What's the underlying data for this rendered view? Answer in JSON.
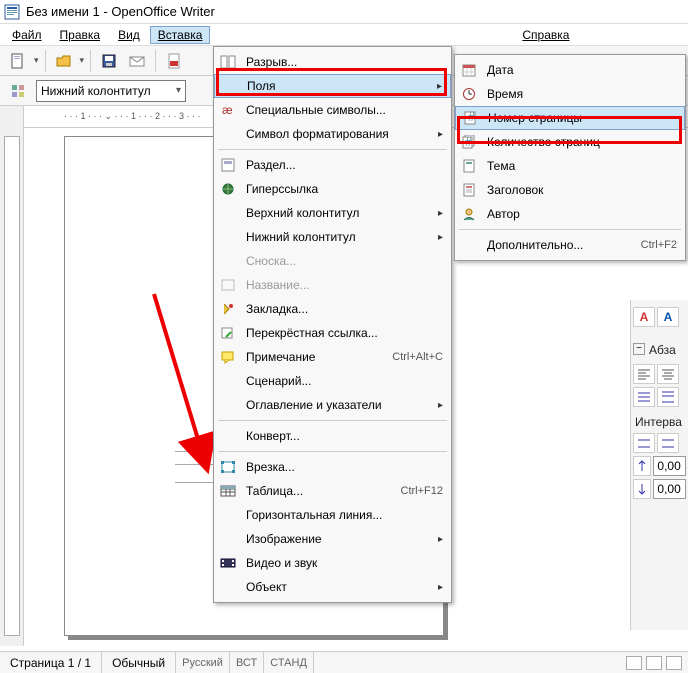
{
  "window": {
    "title": "Без имени 1 - OpenOffice Writer"
  },
  "menubar": {
    "file": "Файл",
    "edit": "Правка",
    "view": "Вид",
    "insert": "Вставка",
    "help": "Справка"
  },
  "toolbar2": {
    "style_value": "Нижний колонтитул"
  },
  "ruler_h": "· · · 1 · · · ⌄ · · · 1 · · · 2 · · · 3 · · ·",
  "insert_menu": {
    "break": "Разрыв...",
    "fields": "Поля",
    "special_chars": "Специальные символы...",
    "formatting_mark": "Символ форматирования",
    "section": "Раздел...",
    "hyperlink": "Гиперссылка",
    "header": "Верхний колонтитул",
    "footer": "Нижний колонтитул",
    "footnote": "Сноска...",
    "caption": "Название...",
    "bookmark": "Закладка...",
    "cross_ref": "Перекрёстная ссылка...",
    "comment": "Примечание",
    "comment_shortcut": "Ctrl+Alt+C",
    "script": "Сценарий...",
    "indexes": "Оглавление и указатели",
    "envelope": "Конверт...",
    "frame": "Врезка...",
    "table": "Таблица...",
    "table_shortcut": "Ctrl+F12",
    "hline": "Горизонтальная линия...",
    "image": "Изображение",
    "movie": "Видео и звук",
    "object": "Объект"
  },
  "fields_submenu": {
    "date": "Дата",
    "time": "Время",
    "page_number": "Номер страницы",
    "page_count": "Количество страниц",
    "subject": "Тема",
    "title": "Заголовок",
    "author": "Автор",
    "other": "Дополнительно...",
    "other_shortcut": "Ctrl+F2"
  },
  "sidebar": {
    "section_paragraph": "Абза",
    "section_interval": "Интерва",
    "spin1": "0,00",
    "spin2": "0,00"
  },
  "statusbar": {
    "page": "Страница  1 / 1",
    "style": "Обычный",
    "lang": "Русский",
    "ins": "ВСТ",
    "std": "СТАНД"
  }
}
